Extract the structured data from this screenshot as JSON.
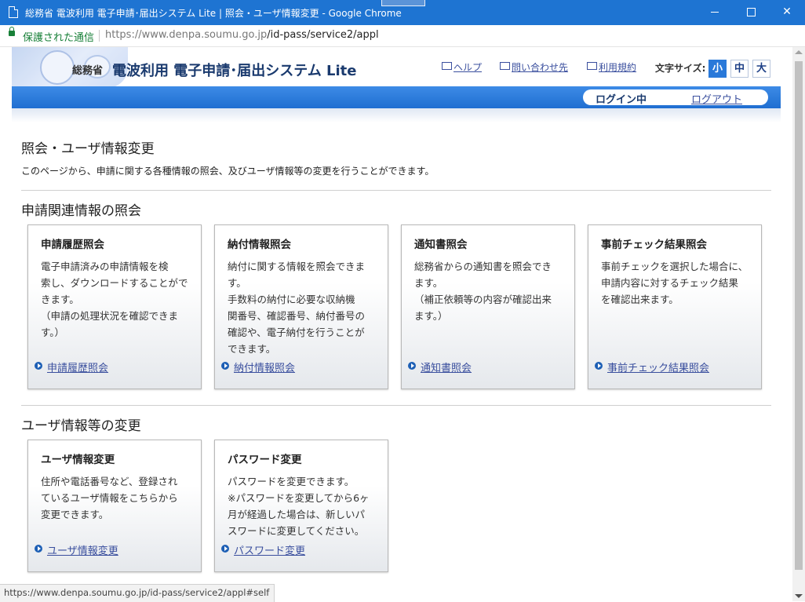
{
  "window": {
    "title": "総務省 電波利用 電子申請･届出システム Lite | 照会・ユーザ情報変更 - Google Chrome"
  },
  "address_bar": {
    "secure_label": "保護された通信",
    "url_host": "https://www.denpa.soumu.go.jp",
    "url_path": "/id-pass/service2/appl"
  },
  "header": {
    "ministry": "総務省",
    "system_name": "電波利用 電子申請･届出システム Lite",
    "links": [
      "ヘルプ",
      "問い合わせ先",
      "利用規約"
    ],
    "font_size_label": "文字サイズ:",
    "font_sizes": [
      "小",
      "中",
      "大"
    ],
    "selected_font_size": "小"
  },
  "nav": {
    "login_status": "ログイン中",
    "logout": "ログアウト"
  },
  "main": {
    "title": "照会・ユーザ情報変更",
    "description": "このページから、申請に関する各種情報の照会、及びユーザ情報等の変更を行うことができます。",
    "sections": [
      {
        "title": "申請関連情報の照会",
        "cards": [
          {
            "title": "申請履歴照会",
            "lines": [
              "電子申請済みの申請情報を検",
              "索し、ダウンロードすることがで",
              "きます。",
              "（申請の処理状況を確認できま",
              "す。）"
            ],
            "link": "申請履歴照会"
          },
          {
            "title": "納付情報照会",
            "lines": [
              "納付に関する情報を照会できま",
              "す。",
              "手数料の納付に必要な収納機",
              "関番号、確認番号、納付番号の",
              "確認や、電子納付を行うことが",
              "できます。"
            ],
            "link": "納付情報照会"
          },
          {
            "title": "通知書照会",
            "lines": [
              "総務省からの通知書を照会でき",
              "ます。",
              "（補正依頼等の内容が確認出来",
              "ます。）"
            ],
            "link": "通知書照会"
          },
          {
            "title": "事前チェック結果照会",
            "lines": [
              "事前チェックを選択した場合に、",
              "申請内容に対するチェック結果",
              "を確認出来ます。"
            ],
            "link": "事前チェック結果照会"
          }
        ]
      },
      {
        "title": "ユーザ情報等の変更",
        "cards": [
          {
            "title": "ユーザ情報変更",
            "lines": [
              "住所や電話番号など、登録され",
              "ているユーザ情報をこちらから",
              "変更できます。"
            ],
            "link": "ユーザ情報変更"
          },
          {
            "title": "パスワード変更",
            "lines": [
              "パスワードを変更できます。",
              "※パスワードを変更してから6ヶ",
              "月が経過した場合は、新しいパ",
              "スワードに変更してください。"
            ],
            "link": "パスワード変更"
          }
        ]
      }
    ]
  },
  "status_url": "https://www.denpa.soumu.go.jp/id-pass/service2/appl#self"
}
